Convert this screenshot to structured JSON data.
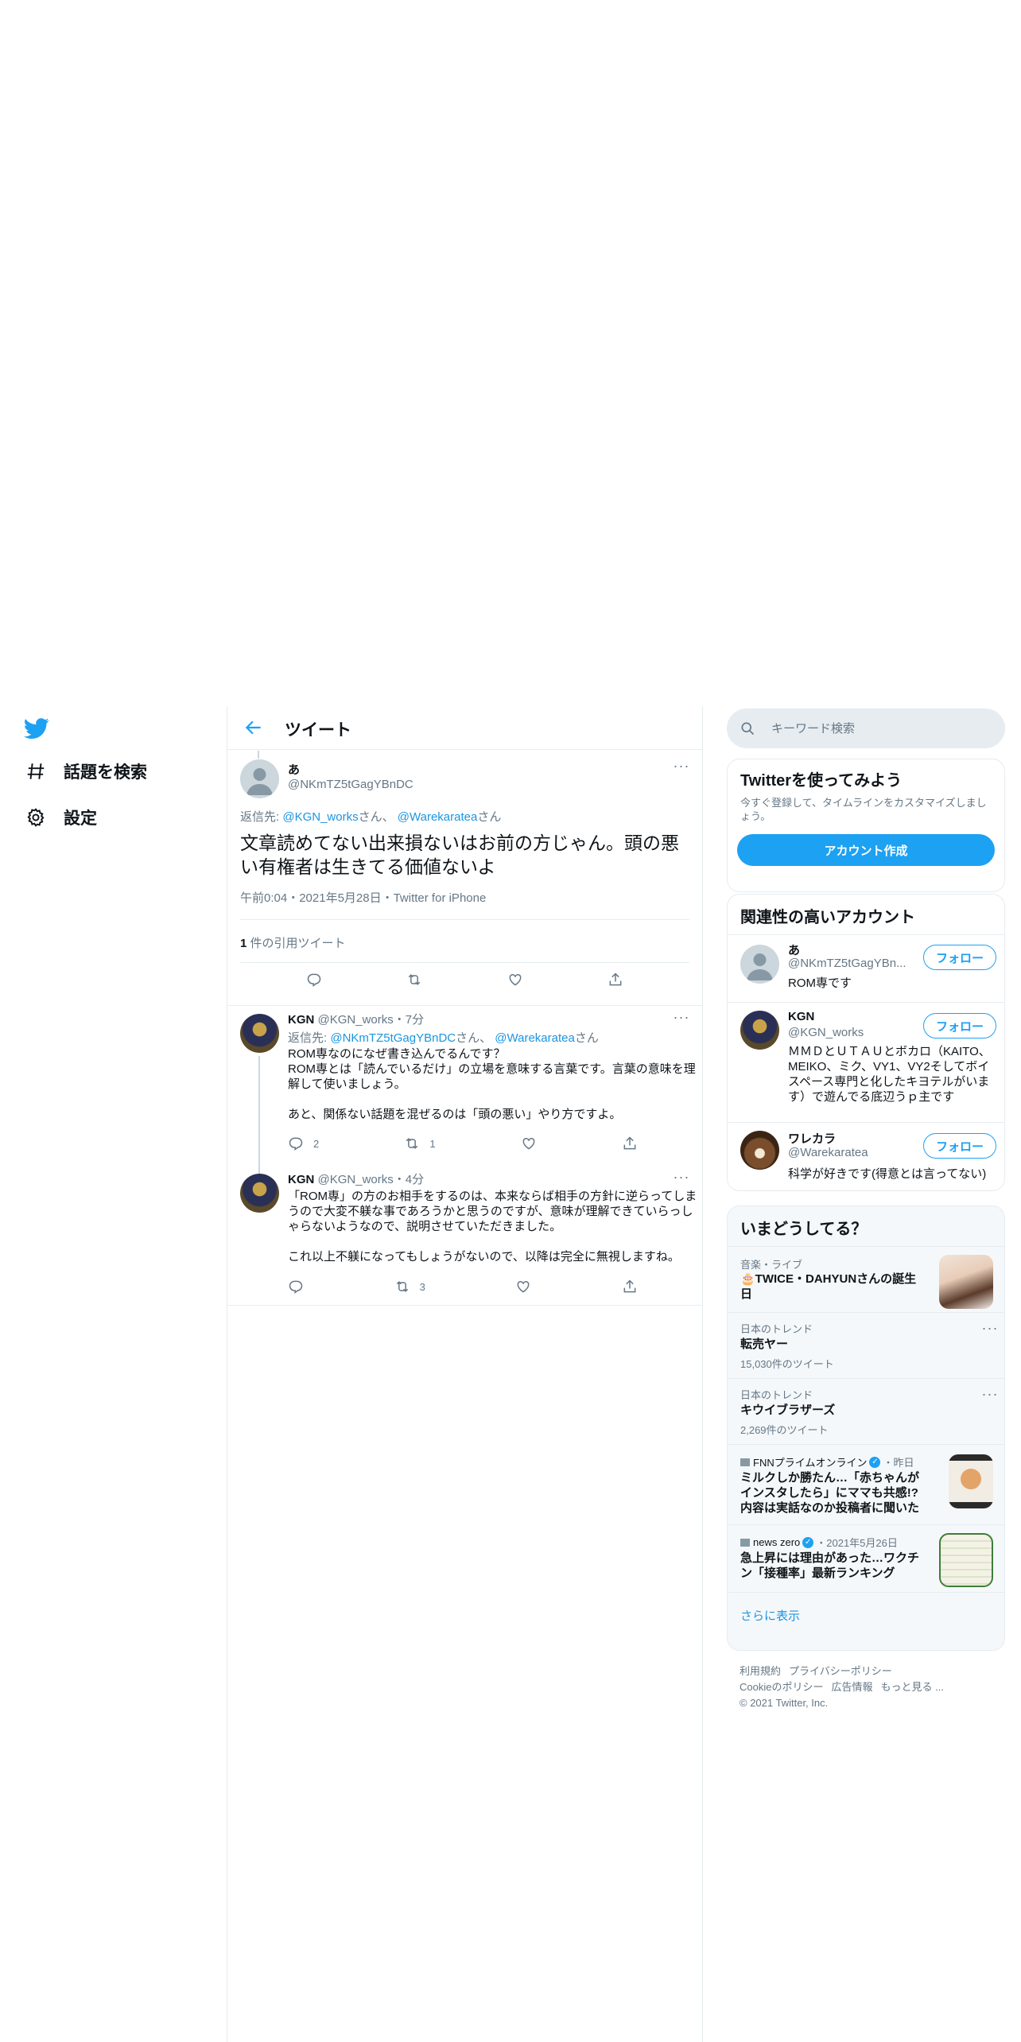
{
  "nav": {
    "logo": "twitter-bird-icon",
    "items": [
      {
        "label": "話題を検索",
        "icon": "hashtag-icon"
      },
      {
        "label": "設定",
        "icon": "gear-icon"
      }
    ]
  },
  "header": {
    "title": "ツイート"
  },
  "tweet": {
    "name": "あ",
    "handle": "@NKmTZ5tGagYBnDC",
    "reply_prefix": "返信先: ",
    "reply_to_1": "@KGN_works",
    "reply_suffix_1": "さん、",
    "reply_to_2": "@Warekaratea",
    "reply_suffix_2": "さん",
    "text": "文章読めてない出来損ないはお前の方じゃん。頭の悪い有権者は生きてる価値ないよ",
    "meta": "午前0:04・2021年5月28日・Twitter for iPhone",
    "quote_count": "1",
    "quote_label": " 件の引用ツイート"
  },
  "replies": [
    {
      "name": "KGN",
      "handle": "@KGN_works",
      "time": "・7分",
      "reply_prefix": "返信先: ",
      "reply_to_1": "@NKmTZ5tGagYBnDC",
      "reply_suffix_1": "さん、",
      "reply_to_2": "@Warekaratea",
      "reply_suffix_2": "さん",
      "line1": "ROM専なのになぜ書き込んでるんです？",
      "line2": "ROM専とは「読んでいるだけ」の立場を意味する言葉です。言葉の意味を理解して使いましょう。",
      "line3": "あと、関係ない話題を混ぜるのは「頭の悪い」やり方ですよ。",
      "reply_count": "2",
      "retweet_count": "1"
    },
    {
      "name": "KGN",
      "handle": "@KGN_works",
      "time": "・4分",
      "line1": "「ROM専」の方のお相手をするのは、本来ならば相手の方針に逆らってしまうので大変不躾な事であろうかと思うのですが、意味が理解できていらっしゃらないようなので、説明させていただきました。",
      "line2": "これ以上不躾になってもしょうがないので、以降は完全に無視しますね。",
      "retweet_count": "3"
    }
  ],
  "search": {
    "placeholder": "キーワード検索"
  },
  "signup": {
    "title": "Twitterを使ってみよう",
    "desc": "今すぐ登録して、タイムラインをカスタマイズしましょう。",
    "button": "アカウント作成"
  },
  "related": {
    "title": "関連性の高いアカウント",
    "follow_label": "フォロー",
    "accounts": [
      {
        "name": "あ",
        "handle": "@NKmTZ5tGagYBn...",
        "bio": "ROM専です"
      },
      {
        "name": "KGN",
        "handle": "@KGN_works",
        "bio": "ＭＭＤとＵＴＡＵとボカロ（KAITO、MEIKO、ミク、VY1、VY2そしてボイスペース専門と化したキヨテルがいます）で遊んでる底辺うｐ主です"
      },
      {
        "name": "ワレカラ",
        "handle": "@Warekaratea",
        "bio": "科学が好きです(得意とは言ってない)"
      }
    ]
  },
  "trends": {
    "title": "いまどうしてる？",
    "items": [
      {
        "context": "音楽・ライブ",
        "title": "🎂TWICE・DAHYUNさんの誕生日"
      },
      {
        "context": "日本のトレンド",
        "title": "転売ヤー",
        "count": "15,030件のツイート"
      },
      {
        "context": "日本のトレンド",
        "title": "キウイブラザーズ",
        "count": "2,269件のツイート"
      },
      {
        "source": "FNNプライムオンライン",
        "time": "・昨日",
        "title": "ミルクしか勝たん…「赤ちゃんがインスタしたら」にママも共感!? 内容は実話なのか投稿者に聞いた"
      },
      {
        "source": "news zero",
        "time": "・2021年5月26日",
        "title": "急上昇には理由があった…ワクチン「接種率」最新ランキング"
      }
    ],
    "show_more": "さらに表示"
  },
  "footer": {
    "links_row1": [
      "利用規約",
      "プライバシーポリシー"
    ],
    "links_row2": [
      "Cookieのポリシー",
      "広告情報",
      "もっと見る ..."
    ],
    "copyright": "© 2021 Twitter, Inc."
  },
  "colors": {
    "accent": "#1da1f2",
    "link": "#1b95e0",
    "text": "#0f1419",
    "muted": "#657786",
    "border": "#e6ecf0"
  }
}
